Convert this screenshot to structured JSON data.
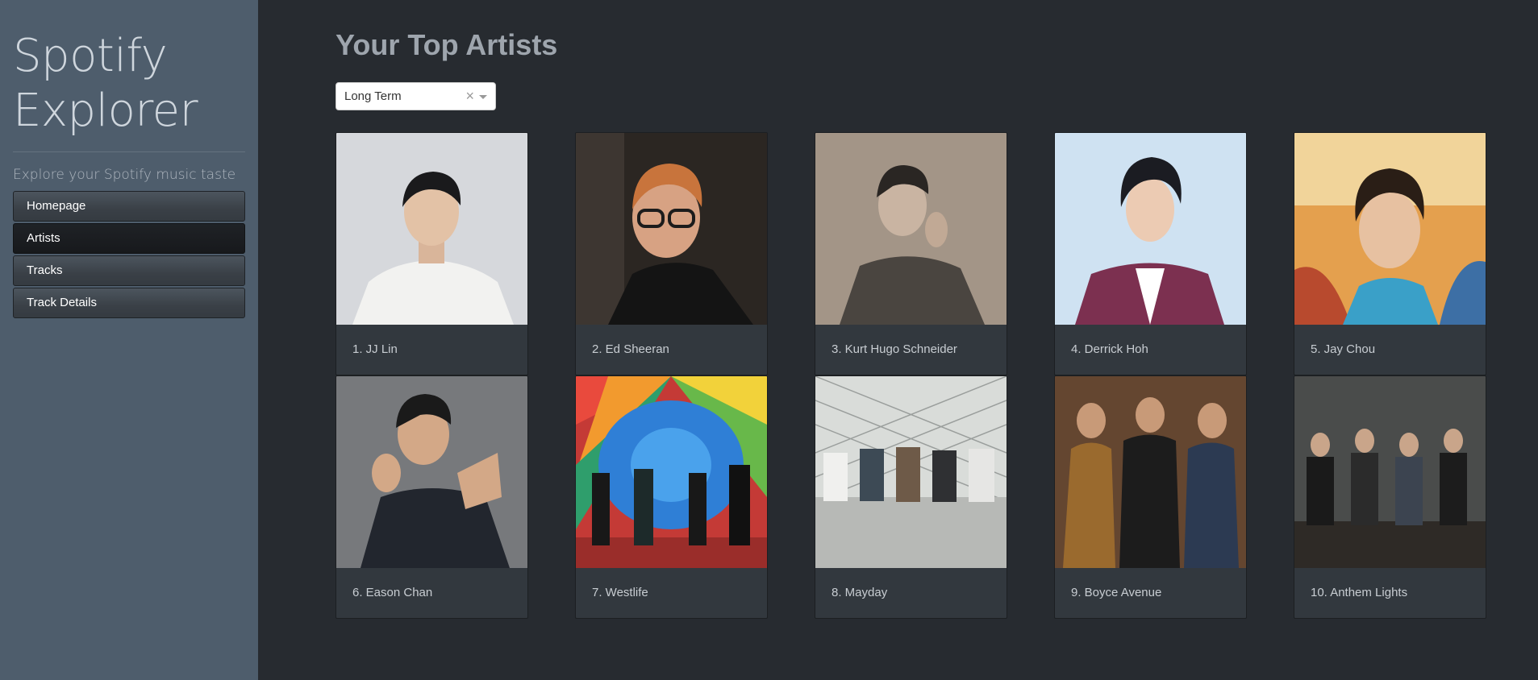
{
  "sidebar": {
    "brand_line1": "Spotify",
    "brand_line2": "Explorer",
    "tagline": "Explore your Spotify music taste",
    "nav": [
      {
        "label": "Homepage",
        "active": false
      },
      {
        "label": "Artists",
        "active": true
      },
      {
        "label": "Tracks",
        "active": false
      },
      {
        "label": "Track Details",
        "active": false
      }
    ]
  },
  "main": {
    "title": "Your Top Artists",
    "term_select": {
      "value": "Long Term",
      "clear_icon": "close-icon",
      "arrow_icon": "chevron-down-icon"
    },
    "artists": [
      {
        "label": "1. JJ Lin",
        "image": "artist-photo-jj-lin"
      },
      {
        "label": "2. Ed Sheeran",
        "image": "artist-photo-ed-sheeran"
      },
      {
        "label": "3. Kurt Hugo Schneider",
        "image": "artist-photo-kurt-hugo-schneider"
      },
      {
        "label": "4. Derrick Hoh",
        "image": "artist-photo-derrick-hoh"
      },
      {
        "label": "5. Jay Chou",
        "image": "artist-photo-jay-chou"
      },
      {
        "label": "6. Eason Chan",
        "image": "artist-photo-eason-chan"
      },
      {
        "label": "7. Westlife",
        "image": "artist-photo-westlife"
      },
      {
        "label": "8. Mayday",
        "image": "artist-photo-mayday"
      },
      {
        "label": "9. Boyce Avenue",
        "image": "artist-photo-boyce-avenue"
      },
      {
        "label": "10. Anthem Lights",
        "image": "artist-photo-anthem-lights"
      }
    ]
  },
  "colors": {
    "sidebar_bg": "#4e5d6c",
    "main_bg": "#272b30",
    "card_bg": "#32383e",
    "active_nav": "#1b1e21"
  }
}
